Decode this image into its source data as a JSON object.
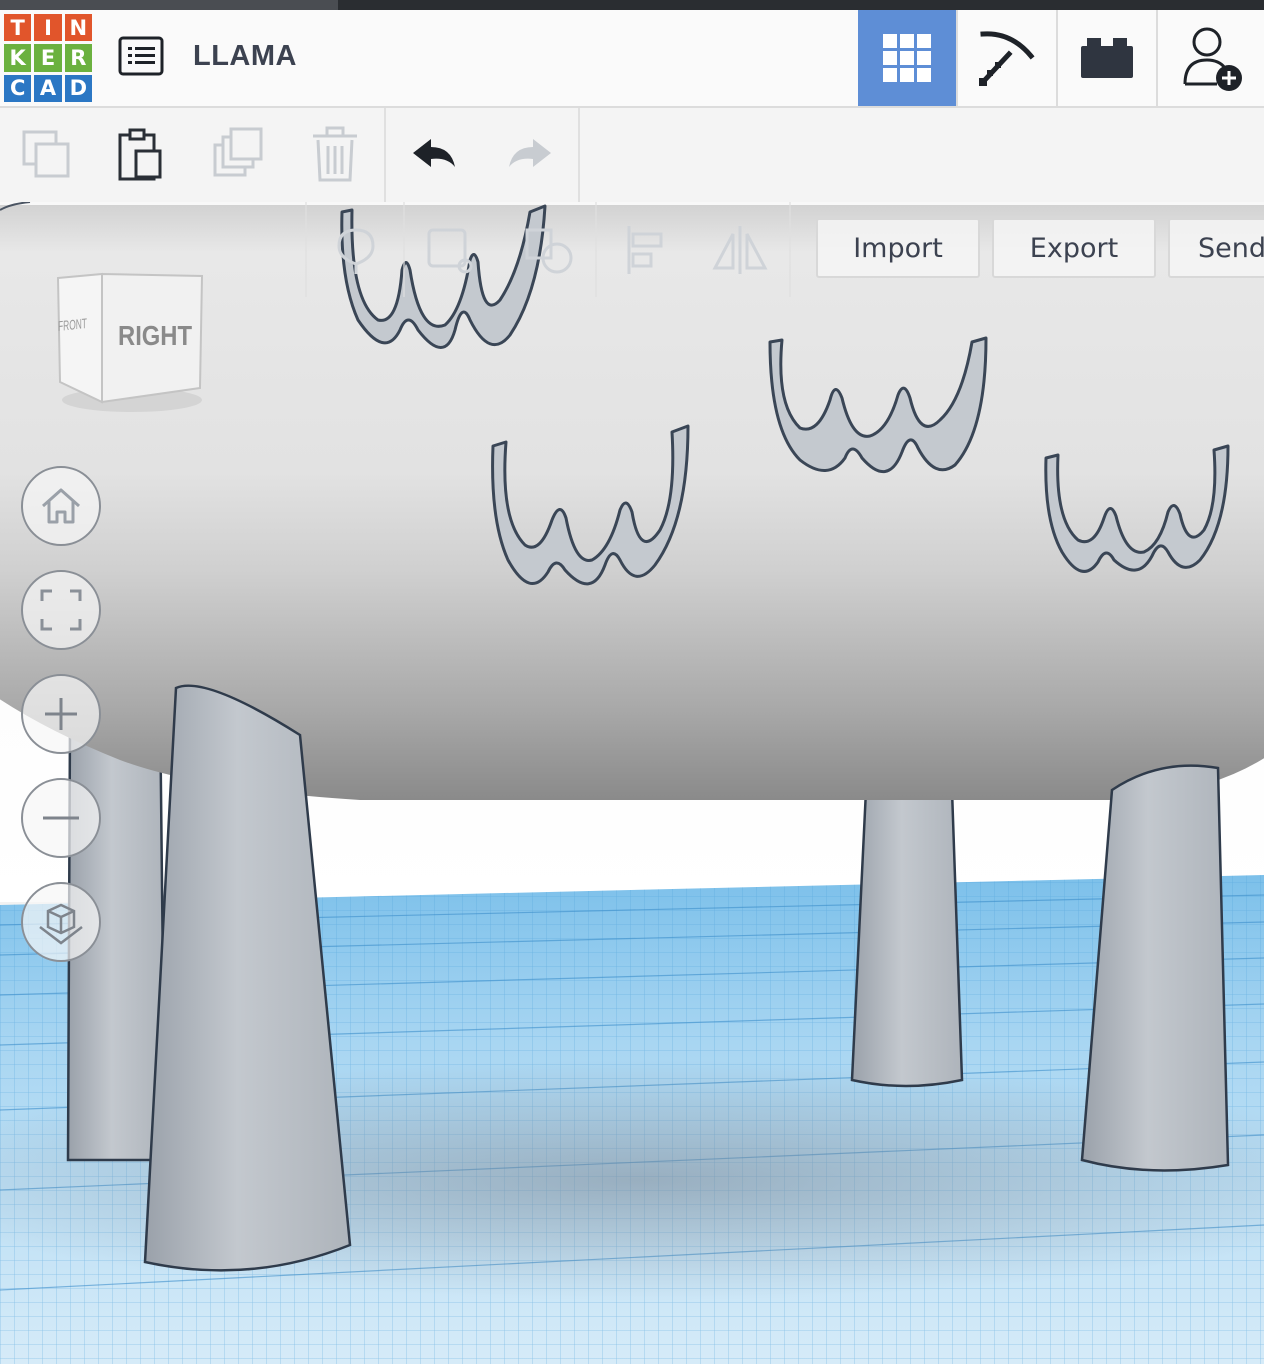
{
  "app": {
    "logo_letters": [
      "T",
      "I",
      "N",
      "K",
      "E",
      "R",
      "C",
      "A",
      "D"
    ],
    "logo_colors": [
      "#e1552b",
      "#e1552b",
      "#e1552b",
      "#6bb13f",
      "#6bb13f",
      "#6bb13f",
      "#2b77c4",
      "#2b77c4",
      "#2b77c4"
    ],
    "design_title": "LLAMA"
  },
  "header_buttons": [
    {
      "name": "3d-design-grid",
      "icon": "grid-icon",
      "active": true
    },
    {
      "name": "codeblocks-minecraft",
      "icon": "pickaxe-icon",
      "active": false
    },
    {
      "name": "bricks",
      "icon": "brick-icon",
      "active": false
    },
    {
      "name": "add-user",
      "icon": "user-add-icon",
      "active": false
    }
  ],
  "toolbar": {
    "copy_icon": "copy-icon",
    "paste_icon": "paste-icon",
    "duplicate_icon": "duplicate-icon",
    "delete_icon": "trash-icon",
    "undo_icon": "undo-icon",
    "redo_icon": "redo-icon"
  },
  "panel": {
    "import_label": "Import",
    "export_label": "Export",
    "send_label": "Send"
  },
  "viewcube": {
    "front_label": "FRONT",
    "right_label": "RIGHT"
  },
  "view_controls": [
    {
      "name": "home-view-button",
      "icon": "home-icon"
    },
    {
      "name": "fit-view-button",
      "icon": "fit-icon"
    },
    {
      "name": "zoom-in-button",
      "icon": "plus-icon"
    },
    {
      "name": "zoom-out-button",
      "icon": "minus-icon"
    },
    {
      "name": "projection-button",
      "icon": "perspective-cube-icon"
    }
  ],
  "colors": {
    "accent": "#5e8ed6",
    "icon_dark": "#3c4250",
    "grid": "#5aa7df"
  }
}
